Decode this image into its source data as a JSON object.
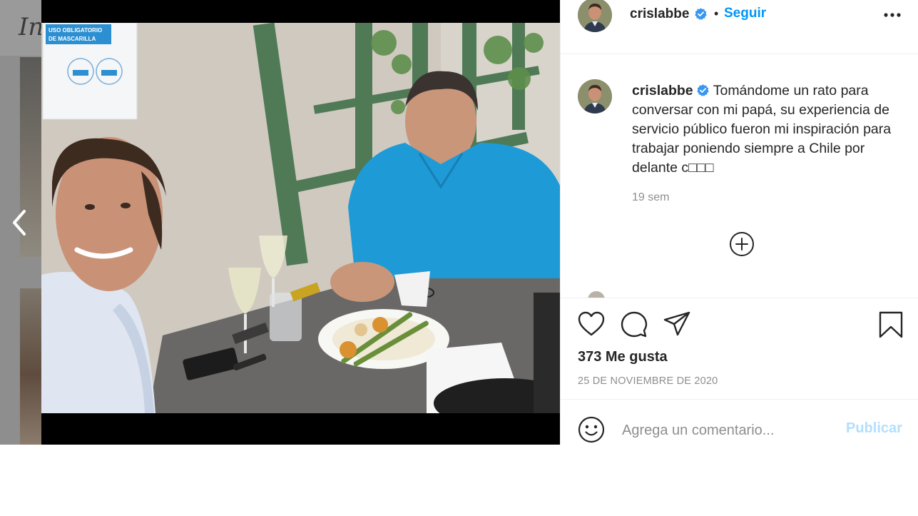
{
  "post": {
    "username": "crislabbe",
    "follow_label": "Seguir",
    "separator": "•",
    "caption": "Tomándome un rato para conversar con mi papá, su experiencia de servicio público fueron mi inspiración para trabajar poniendo siempre a Chile por delante c□□□",
    "time_ago": "19 sem",
    "likes": "373 Me gusta",
    "date": "25 DE NOVIEMBRE DE 2020"
  },
  "photo_sign": {
    "line1": "USO OBLIGATORIO",
    "line2": "DE MASCARILLA"
  },
  "background": {
    "logo_fragment": "In"
  },
  "comment": {
    "placeholder": "Agrega un comentario...",
    "publish_label": "Publicar"
  },
  "icons": {
    "prev": "chevron-left-icon",
    "more": "more-horizontal-icon",
    "verified": "verified-badge-icon",
    "load_more": "plus-circle-icon",
    "like": "heart-icon",
    "comment": "comment-bubble-icon",
    "share": "paper-plane-icon",
    "save": "bookmark-icon",
    "emoji": "smiley-icon"
  },
  "colors": {
    "accent": "#0095f6",
    "accent_disabled": "#b2dffc",
    "verified": "#3897f0",
    "secondary_text": "#8e8e8e",
    "polo_shirt": "#1e9ad6"
  }
}
